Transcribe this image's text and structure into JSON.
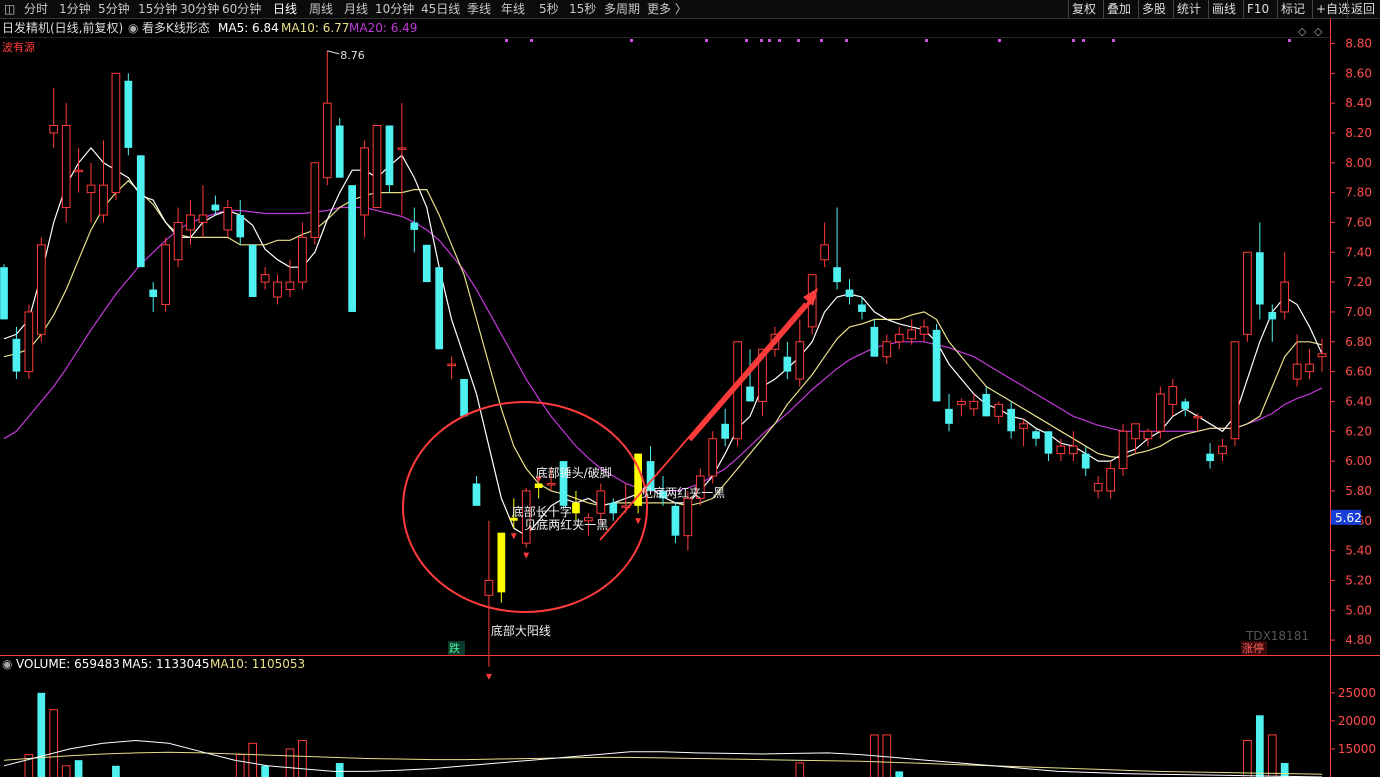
{
  "toolbar": {
    "items": [
      "分时",
      "1分钟",
      "5分钟",
      "15分钟",
      "30分钟",
      "60分钟",
      "日线",
      "周线",
      "月线",
      "10分钟",
      "45日线",
      "季线",
      "年线",
      "5秒",
      "15秒",
      "多周期",
      "更多 〉"
    ],
    "active_index": 6,
    "right_items": [
      "复权",
      "叠加",
      "多股",
      "统计",
      "画线",
      "F10",
      "标记",
      "+自选",
      "返回"
    ]
  },
  "info": {
    "title": "日发精机(日线,前复权)",
    "indicator": "看多K线形态",
    "ma5": "MA5: 6.84",
    "ma10": "MA10: 6.77",
    "ma20": "MA20: 6.49",
    "corner": "波有源"
  },
  "volume_info": {
    "volume": "VOLUME: 659483",
    "ma5": "MA5: 1133045",
    "ma10": "MA10: 1105053"
  },
  "colors": {
    "up": "#ff3b3b",
    "down": "#4ef0f0",
    "highlight": "#ffff00",
    "ma5": "#ffffff",
    "ma10": "#e8e08a",
    "ma20": "#c23ad8",
    "axis": "#ff3b3b",
    "arrow": "#ff3b3b",
    "circle": "#ff3b3b"
  },
  "chart_data": {
    "type": "candlestick",
    "price_axis": {
      "ticks": [
        "8.80",
        "8.60",
        "8.40",
        "8.20",
        "8.00",
        "7.80",
        "7.60",
        "7.40",
        "7.20",
        "7.00",
        "6.80",
        "6.60",
        "6.40",
        "6.20",
        "6.00",
        "5.80",
        "5.60",
        "5.40",
        "5.20",
        "5.00",
        "4.80"
      ],
      "range": [
        4.7,
        8.85
      ]
    },
    "current_price": "5.62",
    "high_marker": "8.76",
    "candles": [
      {
        "o": 7.3,
        "h": 7.32,
        "l": 6.95,
        "c": 6.95
      },
      {
        "o": 6.82,
        "h": 6.9,
        "l": 6.55,
        "c": 6.6
      },
      {
        "o": 6.6,
        "h": 7.05,
        "l": 6.55,
        "c": 7.0
      },
      {
        "o": 6.85,
        "h": 7.5,
        "l": 6.8,
        "c": 7.45
      },
      {
        "o": 8.2,
        "h": 8.5,
        "l": 8.1,
        "c": 8.25
      },
      {
        "o": 7.7,
        "h": 8.4,
        "l": 7.6,
        "c": 8.25
      },
      {
        "o": 7.95,
        "h": 8.1,
        "l": 7.8,
        "c": 7.95
      },
      {
        "o": 7.8,
        "h": 8.0,
        "l": 7.6,
        "c": 7.85
      },
      {
        "o": 7.65,
        "h": 8.15,
        "l": 7.6,
        "c": 7.85
      },
      {
        "o": 7.8,
        "h": 8.6,
        "l": 7.75,
        "c": 8.6
      },
      {
        "o": 8.55,
        "h": 8.6,
        "l": 8.05,
        "c": 8.1
      },
      {
        "o": 8.05,
        "h": 8.05,
        "l": 7.3,
        "c": 7.3
      },
      {
        "o": 7.15,
        "h": 7.2,
        "l": 7.0,
        "c": 7.1
      },
      {
        "o": 7.05,
        "h": 7.5,
        "l": 7.0,
        "c": 7.45
      },
      {
        "o": 7.35,
        "h": 7.7,
        "l": 7.3,
        "c": 7.6
      },
      {
        "o": 7.55,
        "h": 7.75,
        "l": 7.45,
        "c": 7.65
      },
      {
        "o": 7.6,
        "h": 7.85,
        "l": 7.5,
        "c": 7.65
      },
      {
        "o": 7.72,
        "h": 7.78,
        "l": 7.65,
        "c": 7.68
      },
      {
        "o": 7.55,
        "h": 7.75,
        "l": 7.5,
        "c": 7.7
      },
      {
        "o": 7.65,
        "h": 7.75,
        "l": 7.45,
        "c": 7.5
      },
      {
        "o": 7.45,
        "h": 7.45,
        "l": 7.1,
        "c": 7.1
      },
      {
        "o": 7.2,
        "h": 7.3,
        "l": 7.15,
        "c": 7.25
      },
      {
        "o": 7.1,
        "h": 7.25,
        "l": 7.05,
        "c": 7.2
      },
      {
        "o": 7.15,
        "h": 7.35,
        "l": 7.1,
        "c": 7.2
      },
      {
        "o": 7.2,
        "h": 7.6,
        "l": 7.15,
        "c": 7.5
      },
      {
        "o": 7.5,
        "h": 8.0,
        "l": 7.45,
        "c": 8.0
      },
      {
        "o": 7.9,
        "h": 8.75,
        "l": 7.85,
        "c": 8.4
      },
      {
        "o": 8.25,
        "h": 8.3,
        "l": 7.9,
        "c": 7.9
      },
      {
        "o": 7.85,
        "h": 7.85,
        "l": 7.0,
        "c": 7.0
      },
      {
        "o": 7.65,
        "h": 8.15,
        "l": 7.5,
        "c": 8.1
      },
      {
        "o": 7.7,
        "h": 8.25,
        "l": 7.7,
        "c": 8.25
      },
      {
        "o": 8.25,
        "h": 8.25,
        "l": 7.8,
        "c": 7.85
      },
      {
        "o": 8.1,
        "h": 8.4,
        "l": 7.65,
        "c": 8.1
      },
      {
        "o": 7.6,
        "h": 7.7,
        "l": 7.4,
        "c": 7.55
      },
      {
        "o": 7.45,
        "h": 7.45,
        "l": 7.2,
        "c": 7.2
      },
      {
        "o": 7.3,
        "h": 7.3,
        "l": 6.75,
        "c": 6.75
      },
      {
        "o": 6.65,
        "h": 6.7,
        "l": 6.55,
        "c": 6.65
      },
      {
        "o": 6.55,
        "h": 6.55,
        "l": 6.3,
        "c": 6.3
      },
      {
        "o": 5.85,
        "h": 5.9,
        "l": 5.7,
        "c": 5.7
      },
      {
        "o": 5.1,
        "h": 5.6,
        "l": 4.62,
        "c": 5.2
      },
      {
        "o": 5.12,
        "h": 5.52,
        "l": 5.05,
        "c": 5.52
      },
      {
        "o": 5.6,
        "h": 5.75,
        "l": 5.55,
        "c": 5.62
      },
      {
        "o": 5.45,
        "h": 5.82,
        "l": 5.42,
        "c": 5.8
      },
      {
        "o": 5.82,
        "h": 5.85,
        "l": 5.75,
        "c": 5.85
      },
      {
        "o": 5.85,
        "h": 5.95,
        "l": 5.8,
        "c": 5.85
      },
      {
        "o": 6.0,
        "h": 6.0,
        "l": 5.68,
        "c": 5.7
      },
      {
        "o": 5.72,
        "h": 5.8,
        "l": 5.6,
        "c": 5.65
      },
      {
        "o": 5.6,
        "h": 5.65,
        "l": 5.5,
        "c": 5.62
      },
      {
        "o": 5.65,
        "h": 5.85,
        "l": 5.6,
        "c": 5.8
      },
      {
        "o": 5.72,
        "h": 5.75,
        "l": 5.6,
        "c": 5.65
      },
      {
        "o": 5.7,
        "h": 5.85,
        "l": 5.65,
        "c": 5.7
      },
      {
        "o": 5.7,
        "h": 6.05,
        "l": 5.65,
        "c": 6.05
      },
      {
        "o": 6.0,
        "h": 6.1,
        "l": 5.8,
        "c": 5.8
      },
      {
        "o": 5.8,
        "h": 5.9,
        "l": 5.7,
        "c": 5.75
      },
      {
        "o": 5.7,
        "h": 5.72,
        "l": 5.45,
        "c": 5.5
      },
      {
        "o": 5.5,
        "h": 5.8,
        "l": 5.4,
        "c": 5.75
      },
      {
        "o": 5.75,
        "h": 5.95,
        "l": 5.7,
        "c": 5.9
      },
      {
        "o": 5.9,
        "h": 6.2,
        "l": 5.85,
        "c": 6.15
      },
      {
        "o": 6.25,
        "h": 6.35,
        "l": 6.1,
        "c": 6.15
      },
      {
        "o": 6.15,
        "h": 6.8,
        "l": 6.1,
        "c": 6.8
      },
      {
        "o": 6.5,
        "h": 6.75,
        "l": 6.4,
        "c": 6.4
      },
      {
        "o": 6.4,
        "h": 6.75,
        "l": 6.3,
        "c": 6.75
      },
      {
        "o": 6.75,
        "h": 6.9,
        "l": 6.7,
        "c": 6.85
      },
      {
        "o": 6.7,
        "h": 6.8,
        "l": 6.55,
        "c": 6.6
      },
      {
        "o": 6.55,
        "h": 6.95,
        "l": 6.5,
        "c": 6.8
      },
      {
        "o": 6.9,
        "h": 7.25,
        "l": 6.85,
        "c": 7.25
      },
      {
        "o": 7.35,
        "h": 7.6,
        "l": 7.3,
        "c": 7.45
      },
      {
        "o": 7.3,
        "h": 7.7,
        "l": 7.15,
        "c": 7.2
      },
      {
        "o": 7.15,
        "h": 7.22,
        "l": 7.05,
        "c": 7.1
      },
      {
        "o": 7.05,
        "h": 7.1,
        "l": 6.95,
        "c": 7.0
      },
      {
        "o": 6.9,
        "h": 6.95,
        "l": 6.7,
        "c": 6.7
      },
      {
        "o": 6.7,
        "h": 6.85,
        "l": 6.65,
        "c": 6.8
      },
      {
        "o": 6.8,
        "h": 6.9,
        "l": 6.75,
        "c": 6.85
      },
      {
        "o": 6.82,
        "h": 6.95,
        "l": 6.78,
        "c": 6.88
      },
      {
        "o": 6.85,
        "h": 6.95,
        "l": 6.8,
        "c": 6.9
      },
      {
        "o": 6.88,
        "h": 6.92,
        "l": 6.4,
        "c": 6.4
      },
      {
        "o": 6.35,
        "h": 6.45,
        "l": 6.2,
        "c": 6.25
      },
      {
        "o": 6.38,
        "h": 6.42,
        "l": 6.3,
        "c": 6.4
      },
      {
        "o": 6.35,
        "h": 6.45,
        "l": 6.3,
        "c": 6.4
      },
      {
        "o": 6.45,
        "h": 6.5,
        "l": 6.3,
        "c": 6.3
      },
      {
        "o": 6.3,
        "h": 6.4,
        "l": 6.25,
        "c": 6.38
      },
      {
        "o": 6.35,
        "h": 6.4,
        "l": 6.15,
        "c": 6.2
      },
      {
        "o": 6.22,
        "h": 6.28,
        "l": 6.1,
        "c": 6.25
      },
      {
        "o": 6.2,
        "h": 6.22,
        "l": 6.1,
        "c": 6.15
      },
      {
        "o": 6.2,
        "h": 6.2,
        "l": 6.0,
        "c": 6.05
      },
      {
        "o": 6.05,
        "h": 6.15,
        "l": 6.0,
        "c": 6.1
      },
      {
        "o": 6.05,
        "h": 6.2,
        "l": 6.0,
        "c": 6.1
      },
      {
        "o": 6.05,
        "h": 6.1,
        "l": 5.9,
        "c": 5.95
      },
      {
        "o": 5.8,
        "h": 5.9,
        "l": 5.75,
        "c": 5.85
      },
      {
        "o": 5.8,
        "h": 6.0,
        "l": 5.75,
        "c": 5.95
      },
      {
        "o": 5.95,
        "h": 6.25,
        "l": 5.9,
        "c": 6.2
      },
      {
        "o": 6.15,
        "h": 6.25,
        "l": 6.05,
        "c": 6.25
      },
      {
        "o": 6.15,
        "h": 6.22,
        "l": 6.1,
        "c": 6.2
      },
      {
        "o": 6.2,
        "h": 6.5,
        "l": 6.15,
        "c": 6.45
      },
      {
        "o": 6.38,
        "h": 6.55,
        "l": 6.3,
        "c": 6.5
      },
      {
        "o": 6.4,
        "h": 6.42,
        "l": 6.3,
        "c": 6.35
      },
      {
        "o": 6.3,
        "h": 6.32,
        "l": 6.2,
        "c": 6.3
      },
      {
        "o": 6.05,
        "h": 6.12,
        "l": 5.95,
        "c": 6.0
      },
      {
        "o": 6.05,
        "h": 6.15,
        "l": 6.0,
        "c": 6.1
      },
      {
        "o": 6.15,
        "h": 6.8,
        "l": 6.1,
        "c": 6.8
      },
      {
        "o": 6.85,
        "h": 7.4,
        "l": 6.8,
        "c": 7.4
      },
      {
        "o": 7.4,
        "h": 7.6,
        "l": 6.95,
        "c": 7.05
      },
      {
        "o": 7.0,
        "h": 7.05,
        "l": 6.8,
        "c": 6.95
      },
      {
        "o": 7.0,
        "h": 7.4,
        "l": 6.95,
        "c": 7.2
      },
      {
        "o": 6.55,
        "h": 6.85,
        "l": 6.5,
        "c": 6.65
      },
      {
        "o": 6.6,
        "h": 6.75,
        "l": 6.55,
        "c": 6.65
      },
      {
        "o": 6.7,
        "h": 6.82,
        "l": 6.6,
        "c": 6.72
      }
    ],
    "ma5": [
      6.82,
      6.85,
      6.95,
      7.25,
      7.6,
      7.85,
      8.0,
      8.1,
      8.0,
      7.95,
      7.9,
      7.78,
      7.75,
      7.6,
      7.5,
      7.5,
      7.6,
      7.65,
      7.68,
      7.65,
      7.58,
      7.42,
      7.35,
      7.3,
      7.3,
      7.4,
      7.62,
      7.8,
      7.95,
      7.95,
      7.9,
      7.98,
      8.05,
      7.9,
      7.7,
      7.3,
      6.95,
      6.7,
      6.45,
      6.1,
      5.75,
      5.55,
      5.5,
      5.6,
      5.7,
      5.75,
      5.72,
      5.75,
      5.7,
      5.72,
      5.75,
      5.78,
      5.82,
      5.76,
      5.72,
      5.72,
      5.8,
      5.9,
      6.05,
      6.22,
      6.3,
      6.5,
      6.55,
      6.62,
      6.7,
      6.8,
      7.0,
      7.1,
      7.12,
      7.1,
      7.0,
      6.95,
      6.92,
      6.9,
      6.88,
      6.8,
      6.65,
      6.55,
      6.45,
      6.38,
      6.35,
      6.3,
      6.28,
      6.22,
      6.18,
      6.12,
      6.1,
      6.05,
      6.0,
      6.0,
      6.05,
      6.08,
      6.15,
      6.2,
      6.3,
      6.35,
      6.3,
      6.25,
      6.2,
      6.3,
      6.55,
      6.8,
      7.0,
      7.1,
      7.05,
      6.9,
      6.72
    ],
    "ma10": [
      6.7,
      6.72,
      6.75,
      6.85,
      6.98,
      7.15,
      7.35,
      7.55,
      7.7,
      7.8,
      7.88,
      7.8,
      7.72,
      7.6,
      7.52,
      7.5,
      7.5,
      7.5,
      7.5,
      7.45,
      7.45,
      7.45,
      7.48,
      7.48,
      7.52,
      7.55,
      7.62,
      7.7,
      7.75,
      7.78,
      7.8,
      7.8,
      7.8,
      7.82,
      7.82,
      7.65,
      7.45,
      7.25,
      6.95,
      6.65,
      6.35,
      6.1,
      5.95,
      5.85,
      5.8,
      5.78,
      5.75,
      5.72,
      5.7,
      5.72,
      5.72,
      5.72,
      5.72,
      5.72,
      5.72,
      5.7,
      5.72,
      5.75,
      5.85,
      5.95,
      6.05,
      6.15,
      6.25,
      6.38,
      6.48,
      6.58,
      6.7,
      6.82,
      6.9,
      6.92,
      6.95,
      6.95,
      6.95,
      6.98,
      7.0,
      6.95,
      6.8,
      6.7,
      6.6,
      6.5,
      6.45,
      6.4,
      6.35,
      6.3,
      6.25,
      6.2,
      6.15,
      6.1,
      6.05,
      6.03,
      6.02,
      6.05,
      6.07,
      6.1,
      6.15,
      6.18,
      6.2,
      6.22,
      6.22,
      6.22,
      6.25,
      6.3,
      6.5,
      6.7,
      6.8,
      6.8,
      6.78
    ],
    "ma20": [
      6.15,
      6.2,
      6.3,
      6.4,
      6.5,
      6.62,
      6.75,
      6.88,
      7.0,
      7.12,
      7.22,
      7.32,
      7.4,
      7.48,
      7.55,
      7.6,
      7.63,
      7.66,
      7.68,
      7.68,
      7.67,
      7.66,
      7.66,
      7.66,
      7.66,
      7.67,
      7.68,
      7.7,
      7.7,
      7.7,
      7.68,
      7.66,
      7.64,
      7.6,
      7.55,
      7.48,
      7.38,
      7.28,
      7.15,
      7.0,
      6.85,
      6.7,
      6.55,
      6.42,
      6.3,
      6.2,
      6.1,
      6.02,
      5.95,
      5.9,
      5.85,
      5.82,
      5.8,
      5.8,
      5.8,
      5.82,
      5.85,
      5.9,
      5.95,
      6.02,
      6.1,
      6.18,
      6.25,
      6.32,
      6.4,
      6.48,
      6.55,
      6.62,
      6.68,
      6.72,
      6.76,
      6.78,
      6.8,
      6.8,
      6.8,
      6.78,
      6.76,
      6.73,
      6.7,
      6.65,
      6.6,
      6.55,
      6.5,
      6.45,
      6.4,
      6.35,
      6.3,
      6.27,
      6.24,
      6.22,
      6.2,
      6.2,
      6.2,
      6.2,
      6.2,
      6.2,
      6.2,
      6.22,
      6.22,
      6.22,
      6.25,
      6.28,
      6.32,
      6.38,
      6.42,
      6.45,
      6.49
    ],
    "highlight_candles": [
      40,
      41,
      43,
      46,
      51
    ],
    "signal_markers": [
      {
        "i": 39,
        "text": "底部大阳线"
      },
      {
        "i": 41,
        "text": "底部长十字"
      },
      {
        "i": 42,
        "text": "见底两红夹一黑"
      },
      {
        "i": 43,
        "text": "底部锤头/破脚"
      },
      {
        "i": 51,
        "text": "见底两红夹一黑"
      }
    ],
    "down_label": "跌",
    "up_label": "涨停",
    "watermark": "TDX18181",
    "dot_positions": [
      505,
      530,
      630,
      705,
      745,
      760,
      768,
      778,
      797,
      820,
      845,
      925,
      998,
      1072,
      1082,
      1112,
      1288
    ],
    "volume_axis": {
      "ticks": [
        "25000",
        "20000",
        "15000"
      ],
      "range": [
        10000,
        28000
      ]
    },
    "volume": [
      {
        "i": 2,
        "v": 14000,
        "u": true
      },
      {
        "i": 3,
        "v": 25000,
        "u": false
      },
      {
        "i": 4,
        "v": 22000,
        "u": true
      },
      {
        "i": 5,
        "v": 12000,
        "u": true
      },
      {
        "i": 6,
        "v": 13000,
        "u": false
      },
      {
        "i": 9,
        "v": 12000,
        "u": false
      },
      {
        "i": 19,
        "v": 14000,
        "u": true
      },
      {
        "i": 20,
        "v": 16000,
        "u": true
      },
      {
        "i": 21,
        "v": 12000,
        "u": false
      },
      {
        "i": 23,
        "v": 15000,
        "u": true
      },
      {
        "i": 24,
        "v": 16500,
        "u": true
      },
      {
        "i": 27,
        "v": 12500,
        "u": false
      },
      {
        "i": 64,
        "v": 12500,
        "u": true
      },
      {
        "i": 70,
        "v": 17500,
        "u": true
      },
      {
        "i": 71,
        "v": 17500,
        "u": true
      },
      {
        "i": 72,
        "v": 11000,
        "u": false
      },
      {
        "i": 100,
        "v": 16500,
        "u": true
      },
      {
        "i": 101,
        "v": 21000,
        "u": false
      },
      {
        "i": 102,
        "v": 17500,
        "u": true
      },
      {
        "i": 103,
        "v": 12500,
        "u": false
      }
    ],
    "vol_ma5": [
      12000,
      13500,
      15000,
      16000,
      16500,
      16000,
      14500,
      13000,
      12000,
      11500,
      11000,
      11000,
      11200,
      11500,
      12000,
      12500,
      13000,
      13500,
      14000,
      14500,
      14500,
      14300,
      14200,
      14100,
      14200,
      14300,
      14000,
      13500,
      13000,
      12500,
      12000,
      11500,
      11000,
      10800,
      10600,
      10500,
      10400,
      10300,
      10200,
      10100,
      10000
    ],
    "vol_ma10": [
      13000,
      13400,
      13800,
      14100,
      14300,
      14400,
      14300,
      14100,
      13900,
      13700,
      13500,
      13300,
      13200,
      13100,
      13100,
      13200,
      13300,
      13400,
      13500,
      13500,
      13400,
      13300,
      13200,
      13100,
      13000,
      12900,
      12800,
      12600,
      12400,
      12200,
      12000,
      11800,
      11600,
      11400,
      11200,
      11000,
      10900,
      10800,
      10700,
      10600,
      10500
    ]
  }
}
